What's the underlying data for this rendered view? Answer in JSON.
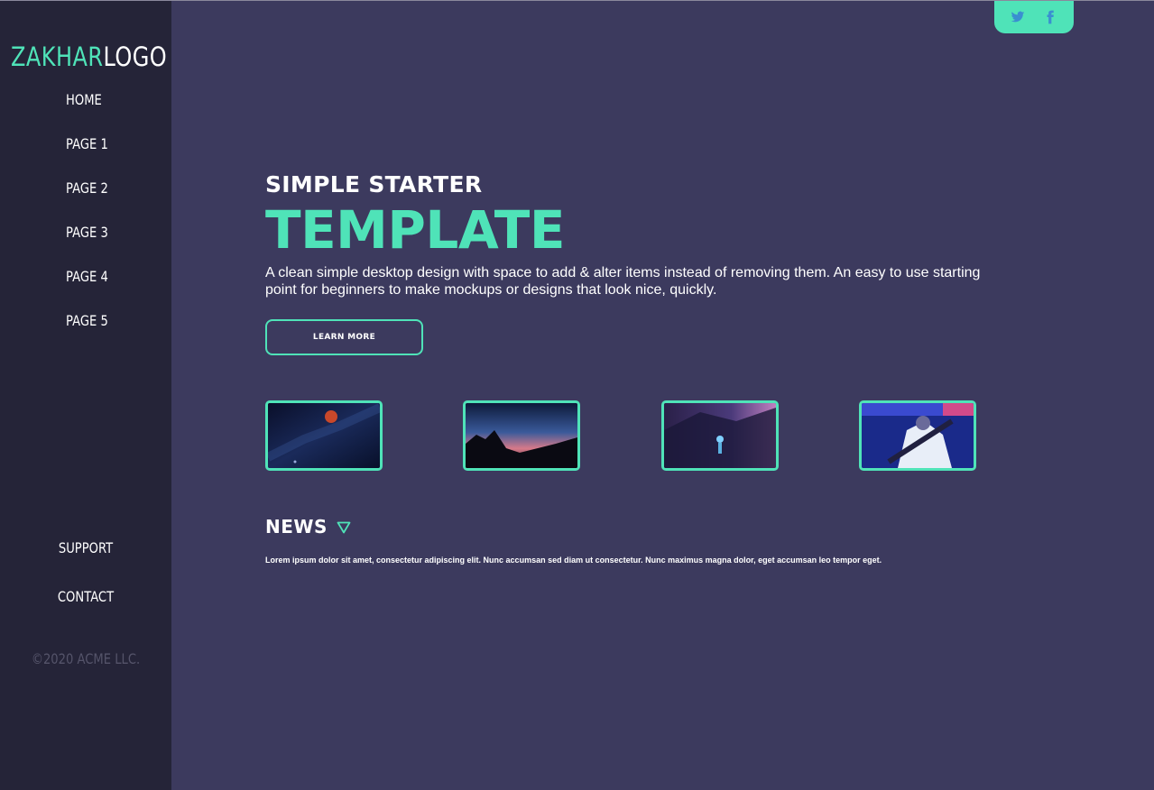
{
  "sidebar": {
    "logo": {
      "part1": "ZAKHAR",
      "part2": "LOGO"
    },
    "nav": [
      "HOME",
      "PAGE 1",
      "PAGE 2",
      "PAGE 3",
      "PAGE 4",
      "PAGE 5"
    ],
    "bottom_nav": [
      "SUPPORT",
      "CONTACT"
    ],
    "copyright": "©2020 ACME LLC."
  },
  "social": {
    "icons": [
      "twitter-icon",
      "facebook-icon"
    ]
  },
  "hero": {
    "subtitle": "SIMPLE STARTER",
    "title": "TEMPLATE",
    "description": "A clean simple desktop design with space to add & alter items instead of removing them. An easy to use starting point for beginners to make mockups or designs that look nice, quickly.",
    "button_label": "LEARN MORE"
  },
  "news": {
    "title": "NEWS",
    "text": "Lorem ipsum dolor sit amet, consectetur adipiscing elit. Nunc accumsan sed diam ut consectetur. Nunc maximus magna dolor, eget accumsan leo tempor eget."
  },
  "colors": {
    "accent": "#4fe3b8",
    "sidebar_bg": "#252438",
    "main_bg": "#3c3a5e"
  }
}
